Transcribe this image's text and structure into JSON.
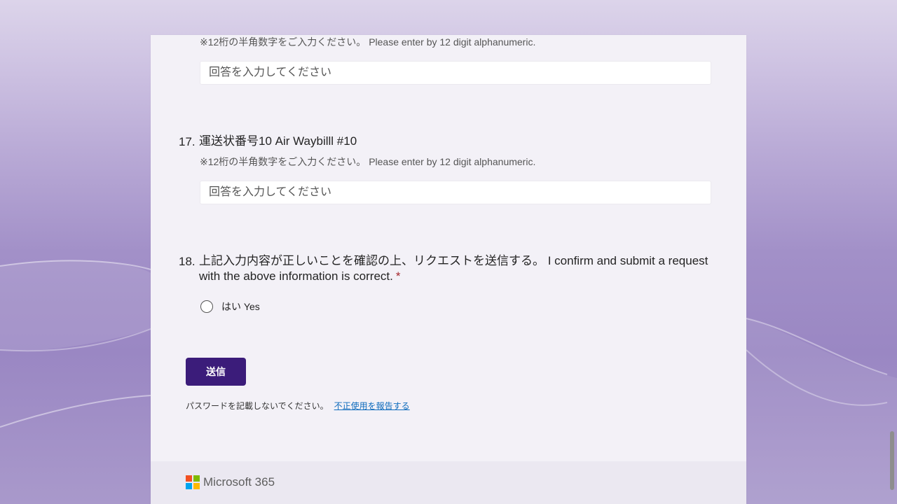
{
  "questions": {
    "q16": {
      "hint": "※12桁の半角数字をご入力ください。 Please enter by 12 digit alphanumeric.",
      "placeholder": "回答を入力してください"
    },
    "q17": {
      "number": "17.",
      "title": "運送状番号10 Air Waybilll #10",
      "hint": "※12桁の半角数字をご入力ください。 Please enter by 12 digit alphanumeric.",
      "placeholder": "回答を入力してください"
    },
    "q18": {
      "number": "18.",
      "title_line1": "上記入力内容が正しいことを確認の上、リクエストを送信する。 I confirm and submit a request",
      "title_line2": "with the above information is correct.",
      "required_mark": "*",
      "option": "はい Yes"
    }
  },
  "submit": {
    "label": "送信"
  },
  "note": {
    "text": "パスワードを記載しないでください。",
    "link": "不正使用を報告する"
  },
  "footer": {
    "brand": "Microsoft 365"
  },
  "colors": {
    "accent": "#3b1c7a",
    "required": "#a4262c",
    "link": "#0f6cbd",
    "ms_red": "#f25022",
    "ms_green": "#7fba00",
    "ms_blue": "#00a4ef",
    "ms_yellow": "#ffb900"
  }
}
